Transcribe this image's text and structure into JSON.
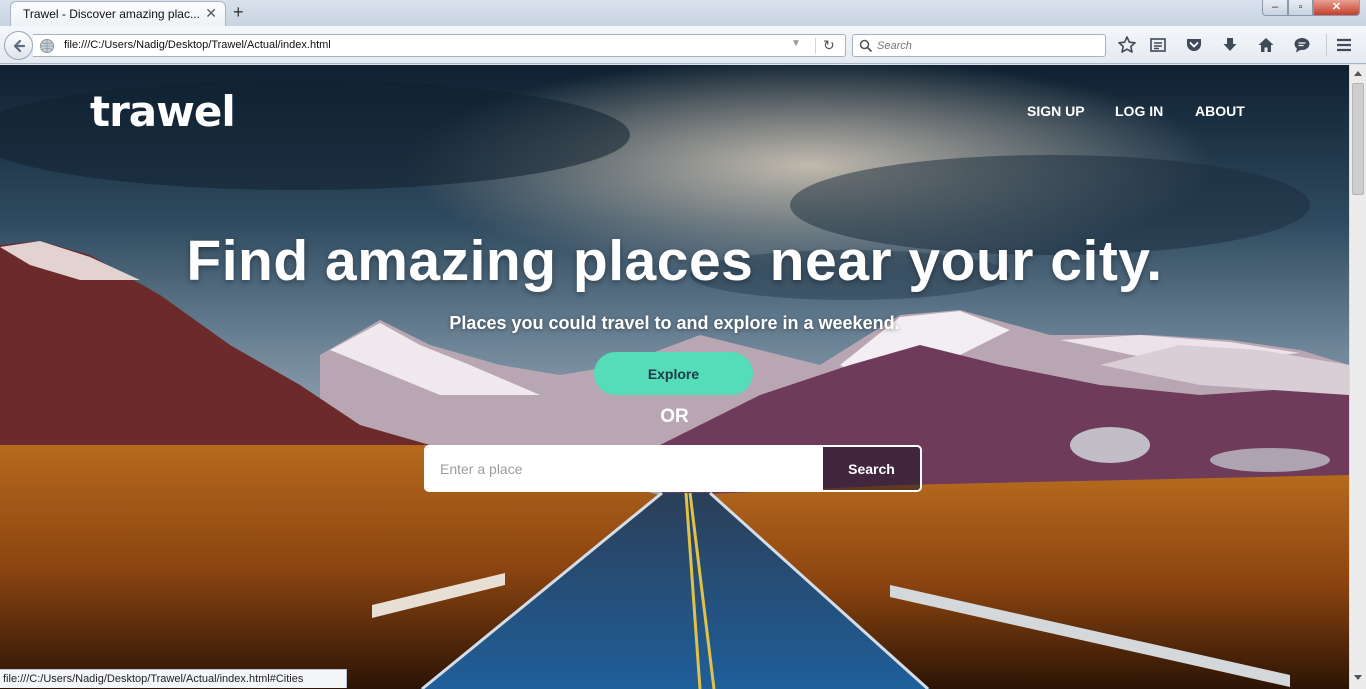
{
  "browser": {
    "tab_title": "Trawel - Discover amazing plac...",
    "tab_close": "✕",
    "new_tab": "+",
    "window_controls": {
      "minimize": "–",
      "maximize": "▫",
      "close": "✕"
    },
    "url": "file:///C:/Users/Nadig/Desktop/Trawel/Actual/index.html",
    "search_placeholder": "Search",
    "toolbar_icons": [
      "bookmark-star-icon",
      "reading-list-icon",
      "pocket-icon",
      "download-icon",
      "home-icon",
      "chat-icon",
      "menu-icon"
    ],
    "status_url": "file:///C:/Users/Nadig/Desktop/Trawel/Actual/index.html#Cities"
  },
  "site": {
    "logo": "trawel",
    "nav": {
      "signup": "SIGN UP",
      "login": "LOG IN",
      "about": "ABOUT"
    },
    "headline": "Find amazing places near your city.",
    "subheadline": "Places you could travel to and explore in a weekend.",
    "explore_label": "Explore",
    "or_label": "OR",
    "place_placeholder": "Enter a place",
    "search_label": "Search"
  },
  "colors": {
    "accent": "#55dcb9",
    "hero_overlay": "#1b2a3a"
  }
}
